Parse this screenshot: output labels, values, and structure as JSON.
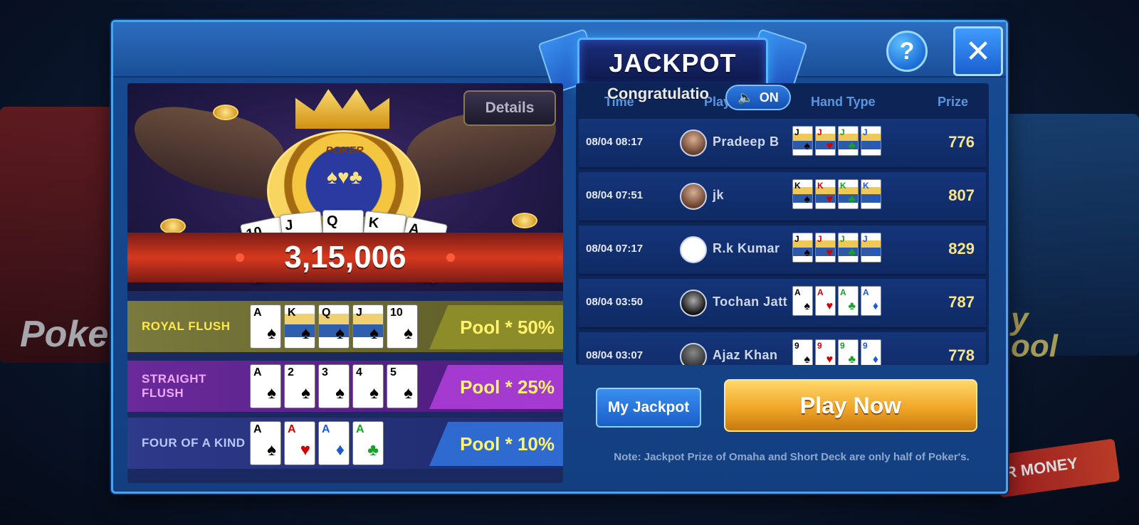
{
  "background": {
    "left_text": "Poke",
    "right_text": "y\nool",
    "bottom_right_text": "R MONEY"
  },
  "modal": {
    "title": "JACKPOT",
    "help_label": "?",
    "close_label": "✕"
  },
  "left": {
    "details_label": "Details",
    "chip_label": "POKER",
    "chip_suits": "♠♥♣",
    "jackpot_amount": "3,15,006",
    "hero_cards": [
      "10",
      "J",
      "Q",
      "K",
      "A"
    ],
    "payouts": [
      {
        "hand": "ROYAL FLUSH",
        "pool": "Pool  *  50%",
        "cards": [
          {
            "rank": "A",
            "suit": "♠",
            "face": false
          },
          {
            "rank": "K",
            "suit": "♠",
            "face": true
          },
          {
            "rank": "Q",
            "suit": "♠",
            "face": true
          },
          {
            "rank": "J",
            "suit": "♠",
            "face": true
          },
          {
            "rank": "10",
            "suit": "♠",
            "face": false
          }
        ]
      },
      {
        "hand": "STRAIGHT FLUSH",
        "pool": "Pool  *  25%",
        "cards": [
          {
            "rank": "A",
            "suit": "♠",
            "face": false
          },
          {
            "rank": "2",
            "suit": "♠",
            "face": false
          },
          {
            "rank": "3",
            "suit": "♠",
            "face": false
          },
          {
            "rank": "4",
            "suit": "♠",
            "face": false
          },
          {
            "rank": "5",
            "suit": "♠",
            "face": false
          }
        ]
      },
      {
        "hand": "FOUR OF A KIND",
        "pool": "Pool  *  10%",
        "cards": [
          {
            "rank": "A",
            "suit": "♠",
            "face": false,
            "color": "black"
          },
          {
            "rank": "A",
            "suit": "♥",
            "face": false,
            "color": "red"
          },
          {
            "rank": "A",
            "suit": "♦",
            "face": false,
            "color": "blue"
          },
          {
            "rank": "A",
            "suit": "♣",
            "face": false,
            "color": "green"
          }
        ]
      }
    ]
  },
  "right": {
    "congrats_label": "Congratulatio",
    "sound_label": "ON",
    "columns": [
      "Time",
      "Player",
      "Hand Type",
      "Prize"
    ],
    "winners": [
      {
        "time": "08/04  08:17",
        "player": "Pradeep  B",
        "avatar": "photo",
        "rank": "J",
        "face": true,
        "prize": "776"
      },
      {
        "time": "08/04  07:51",
        "player": "jk",
        "avatar": "photo",
        "rank": "K",
        "face": true,
        "prize": "807"
      },
      {
        "time": "08/04  07:17",
        "player": "R.k  Kumar",
        "avatar": "blank",
        "rank": "J",
        "face": true,
        "prize": "829"
      },
      {
        "time": "08/04  03:50",
        "player": "Tochan  Jatt",
        "avatar": "dark",
        "rank": "A",
        "face": false,
        "prize": "787"
      },
      {
        "time": "08/04  03:07",
        "player": "Ajaz  Khan",
        "avatar": "grey",
        "rank": "9",
        "face": false,
        "prize": "778"
      }
    ],
    "my_jackpot_label": "My  Jackpot",
    "play_now_label": "Play  Now",
    "note": "Note:  Jackpot  Prize  of  Omaha  and  Short  Deck  are  only  half  of  Poker's."
  },
  "colors": {
    "accent": "#4aa4ee",
    "prize": "#f8e58a",
    "pool": "#fff46a",
    "play_now": "#f0a628"
  }
}
